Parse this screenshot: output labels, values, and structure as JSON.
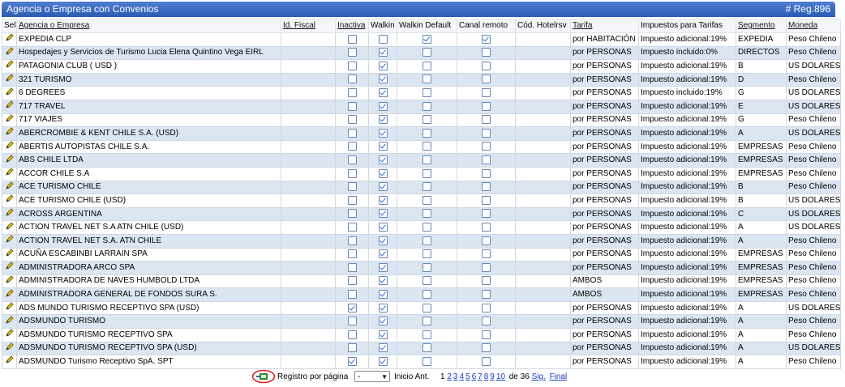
{
  "window": {
    "title": "Agencia o Empresa con Convenios",
    "reg": "# Reg.896"
  },
  "columns": [
    "Sel",
    "Agencia o Empresa",
    "Id. Fiscal",
    "Inactiva",
    "Walkin",
    "Walkin Default",
    "Canal remoto",
    "Cód. Hotelrsv",
    "Tarifa",
    "Impuestos para Tarifas",
    "Segmento",
    "Moneda"
  ],
  "rows": [
    {
      "name": "EXPEDIA CLP",
      "inactiva": false,
      "walkin": false,
      "walkin_default": true,
      "canal": true,
      "tarifa": "por HABITACIÓN",
      "impuesto": "Impuesto adicional:19%",
      "segmento": "EXPEDIA",
      "moneda": "Peso Chileno"
    },
    {
      "name": "Hospedajes y Servicios de Turismo Lucia Elena Quintino Vega EIRL",
      "inactiva": false,
      "walkin": true,
      "walkin_default": false,
      "canal": false,
      "tarifa": "por PERSONAS",
      "impuesto": "Impuesto incluido:0%",
      "segmento": "DIRECTOS",
      "moneda": "Peso Chileno"
    },
    {
      "name": "PATAGONIA CLUB ( USD )",
      "inactiva": false,
      "walkin": true,
      "walkin_default": false,
      "canal": false,
      "tarifa": "por PERSONAS",
      "impuesto": "Impuesto adicional:19%",
      "segmento": "B",
      "moneda": "US DOLARES"
    },
    {
      "name": "321 TURISMO",
      "inactiva": false,
      "walkin": true,
      "walkin_default": false,
      "canal": false,
      "tarifa": "por PERSONAS",
      "impuesto": "Impuesto adicional:19%",
      "segmento": "D",
      "moneda": "Peso Chileno"
    },
    {
      "name": "6 DEGREES",
      "inactiva": false,
      "walkin": true,
      "walkin_default": false,
      "canal": false,
      "tarifa": "por PERSONAS",
      "impuesto": "Impuesto incluido:19%",
      "segmento": "G",
      "moneda": "US DOLARES"
    },
    {
      "name": "717 TRAVEL",
      "inactiva": false,
      "walkin": true,
      "walkin_default": false,
      "canal": false,
      "tarifa": "por PERSONAS",
      "impuesto": "Impuesto adicional:19%",
      "segmento": "E",
      "moneda": "US DOLARES"
    },
    {
      "name": "717 VIAJES",
      "inactiva": false,
      "walkin": true,
      "walkin_default": false,
      "canal": false,
      "tarifa": "por PERSONAS",
      "impuesto": "Impuesto adicional:19%",
      "segmento": "G",
      "moneda": "Peso Chileno"
    },
    {
      "name": "ABERCROMBIE & KENT CHILE S.A. (USD)",
      "inactiva": false,
      "walkin": true,
      "walkin_default": false,
      "canal": false,
      "tarifa": "por PERSONAS",
      "impuesto": "Impuesto adicional:19%",
      "segmento": "A",
      "moneda": "US DOLARES"
    },
    {
      "name": "ABERTIS AUTOPISTAS CHILE S.A.",
      "inactiva": false,
      "walkin": true,
      "walkin_default": false,
      "canal": false,
      "tarifa": "por PERSONAS",
      "impuesto": "Impuesto adicional:19%",
      "segmento": "EMPRESAS",
      "moneda": "Peso Chileno"
    },
    {
      "name": "ABS CHILE LTDA",
      "inactiva": false,
      "walkin": true,
      "walkin_default": false,
      "canal": false,
      "tarifa": "por PERSONAS",
      "impuesto": "Impuesto adicional:19%",
      "segmento": "EMPRESAS",
      "moneda": "Peso Chileno"
    },
    {
      "name": "ACCOR CHILE S.A",
      "inactiva": false,
      "walkin": true,
      "walkin_default": false,
      "canal": false,
      "tarifa": "por PERSONAS",
      "impuesto": "Impuesto adicional:19%",
      "segmento": "EMPRESAS",
      "moneda": "Peso Chileno"
    },
    {
      "name": "ACE TURISMO CHILE",
      "inactiva": false,
      "walkin": true,
      "walkin_default": false,
      "canal": false,
      "tarifa": "por PERSONAS",
      "impuesto": "Impuesto adicional:19%",
      "segmento": "B",
      "moneda": "Peso Chileno"
    },
    {
      "name": "ACE TURISMO CHILE (USD)",
      "inactiva": false,
      "walkin": true,
      "walkin_default": false,
      "canal": false,
      "tarifa": "por PERSONAS",
      "impuesto": "Impuesto adicional:19%",
      "segmento": "B",
      "moneda": "US DOLARES"
    },
    {
      "name": "ACROSS ARGENTINA",
      "inactiva": false,
      "walkin": true,
      "walkin_default": false,
      "canal": false,
      "tarifa": "por PERSONAS",
      "impuesto": "Impuesto adicional:19%",
      "segmento": "C",
      "moneda": "US DOLARES"
    },
    {
      "name": "ACTION TRAVEL NET S.A ATN CHILE (USD)",
      "inactiva": false,
      "walkin": true,
      "walkin_default": false,
      "canal": false,
      "tarifa": "por PERSONAS",
      "impuesto": "Impuesto adicional:19%",
      "segmento": "A",
      "moneda": "US DOLARES"
    },
    {
      "name": "ACTION TRAVEL NET S.A. ATN CHILE",
      "inactiva": false,
      "walkin": true,
      "walkin_default": false,
      "canal": false,
      "tarifa": "por PERSONAS",
      "impuesto": "Impuesto adicional:19%",
      "segmento": "A",
      "moneda": "Peso Chileno"
    },
    {
      "name": "ACUÑA ESCABINBI LARRAIN SPA",
      "inactiva": false,
      "walkin": true,
      "walkin_default": false,
      "canal": false,
      "tarifa": "por PERSONAS",
      "impuesto": "Impuesto adicional:19%",
      "segmento": "EMPRESAS",
      "moneda": "Peso Chileno"
    },
    {
      "name": "ADMINISTRADORA ARCO SPA",
      "inactiva": false,
      "walkin": true,
      "walkin_default": false,
      "canal": false,
      "tarifa": "por PERSONAS",
      "impuesto": "Impuesto adicional:19%",
      "segmento": "EMPRESAS",
      "moneda": "Peso Chileno"
    },
    {
      "name": "ADMINISTRADORA DE NAVES HUMBOLD LTDA",
      "inactiva": false,
      "walkin": true,
      "walkin_default": false,
      "canal": false,
      "tarifa": "AMBOS",
      "impuesto": "Impuesto adicional:19%",
      "segmento": "EMPRESAS",
      "moneda": "Peso Chileno"
    },
    {
      "name": "ADMINISTRADORA GENERAL DE FONDOS SURA S.",
      "inactiva": false,
      "walkin": true,
      "walkin_default": false,
      "canal": false,
      "tarifa": "AMBOS",
      "impuesto": "Impuesto adicional:19%",
      "segmento": "EMPRESAS",
      "moneda": "Peso Chileno"
    },
    {
      "name": "ADS MUNDO TURISMO RECEPTIVO SPA (USD)",
      "inactiva": true,
      "walkin": true,
      "walkin_default": false,
      "canal": false,
      "tarifa": "por PERSONAS",
      "impuesto": "Impuesto adicional:19%",
      "segmento": "A",
      "moneda": "US DOLARES"
    },
    {
      "name": "ADSMUNDO TURISMO",
      "inactiva": false,
      "walkin": true,
      "walkin_default": false,
      "canal": false,
      "tarifa": "por PERSONAS",
      "impuesto": "Impuesto adicional:19%",
      "segmento": "A",
      "moneda": "Peso Chileno"
    },
    {
      "name": "ADSMUNDO TURISMO RECEPTIVO SPA",
      "inactiva": false,
      "walkin": true,
      "walkin_default": false,
      "canal": false,
      "tarifa": "por PERSONAS",
      "impuesto": "Impuesto adicional:19%",
      "segmento": "A",
      "moneda": "Peso Chileno"
    },
    {
      "name": "ADSMUNDO TURISMO RECEPTIVO SPA (USD)",
      "inactiva": false,
      "walkin": true,
      "walkin_default": false,
      "canal": false,
      "tarifa": "por PERSONAS",
      "impuesto": "Impuesto adicional:19%",
      "segmento": "A",
      "moneda": "US DOLARES"
    },
    {
      "name": "ADSMUNDO Turismo Receptivo SpA. SPT",
      "inactiva": true,
      "walkin": true,
      "walkin_default": false,
      "canal": false,
      "tarifa": "por PERSONAS",
      "impuesto": "Impuesto adicional:19%",
      "segmento": "A",
      "moneda": "Peso Chileno"
    }
  ],
  "footer": {
    "per_page_label": "Registro por página",
    "per_page_value": "-",
    "inicio_label": "Inicio Ant.",
    "page_current": "1",
    "pages": [
      "2",
      "3",
      "4",
      "5",
      "6",
      "7",
      "8",
      "9",
      "10"
    ],
    "of_label": "de 36",
    "next_label": "Sig.",
    "last_label": "Final"
  }
}
